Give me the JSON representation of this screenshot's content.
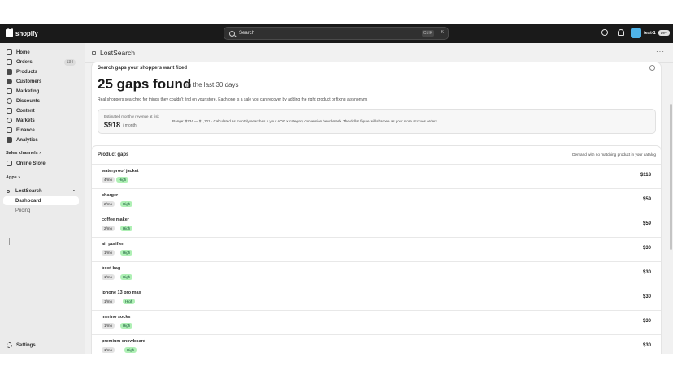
{
  "topbar": {
    "brand": "shopify",
    "search_placeholder": "Search",
    "search_shortcut": "CtrlK",
    "search_shortcut_x": "K",
    "store_name": "test-1",
    "store_tag": "Dev"
  },
  "sidebar": {
    "items": [
      {
        "label": "Home"
      },
      {
        "label": "Orders",
        "count": "134"
      },
      {
        "label": "Products"
      },
      {
        "label": "Customers"
      },
      {
        "label": "Marketing"
      },
      {
        "label": "Discounts"
      },
      {
        "label": "Content"
      },
      {
        "label": "Markets"
      },
      {
        "label": "Finance"
      },
      {
        "label": "Analytics"
      }
    ],
    "sales_channels_label": "Sales channels",
    "online_store_label": "Online Store",
    "apps_label": "Apps",
    "app_name": "LostSearch",
    "app_subitems": [
      "Dashboard",
      "Pricing"
    ],
    "settings_label": "Settings"
  },
  "main": {
    "app_title": "LostSearch",
    "more_label": "···"
  },
  "summary": {
    "title": "Search gaps your shoppers want fixed",
    "gaps_count": "25 gaps found",
    "period": "in the last 30 days",
    "description": "Real shoppers searched for things they couldn't find on your store. Each one is a sale you can recover by adding the right product or fixing a synonym.",
    "est_label": "Estimated monthly revenue at risk",
    "est_value": "$918",
    "est_unit": "/ month",
    "range_note": "Range: $734 — $1,101 · Calculated as monthly searches × your AOV × category conversion benchmark. The dollar figure will sharpen as your store accrues orders."
  },
  "gaps": {
    "title": "Product gaps",
    "note": "Demand with no matching product in your catalog",
    "rows": [
      {
        "term": "waterproof jacket",
        "freq": "4/mo",
        "level": "High",
        "amount": "$118"
      },
      {
        "term": "charger",
        "freq": "2/mo",
        "level": "High",
        "amount": "$59"
      },
      {
        "term": "coffee maker",
        "freq": "2/mo",
        "level": "High",
        "amount": "$59"
      },
      {
        "term": "air purifier",
        "freq": "1/mo",
        "level": "High",
        "amount": "$30"
      },
      {
        "term": "boot bag",
        "freq": "1/mo",
        "level": "High",
        "amount": "$30"
      },
      {
        "term": "iphone 13 pro max",
        "freq": "1/mo",
        "level": "High",
        "amount": "$30"
      },
      {
        "term": "merino socks",
        "freq": "1/mo",
        "level": "High",
        "amount": "$30"
      },
      {
        "term": "premium snowboard",
        "freq": "1/mo",
        "level": "High",
        "amount": "$30"
      }
    ]
  },
  "colors": {
    "topbar": "#1a1a1a",
    "sidebar": "#ebebeb",
    "main_bg": "#f1f1f1",
    "badge_success": "#aff0b5"
  }
}
